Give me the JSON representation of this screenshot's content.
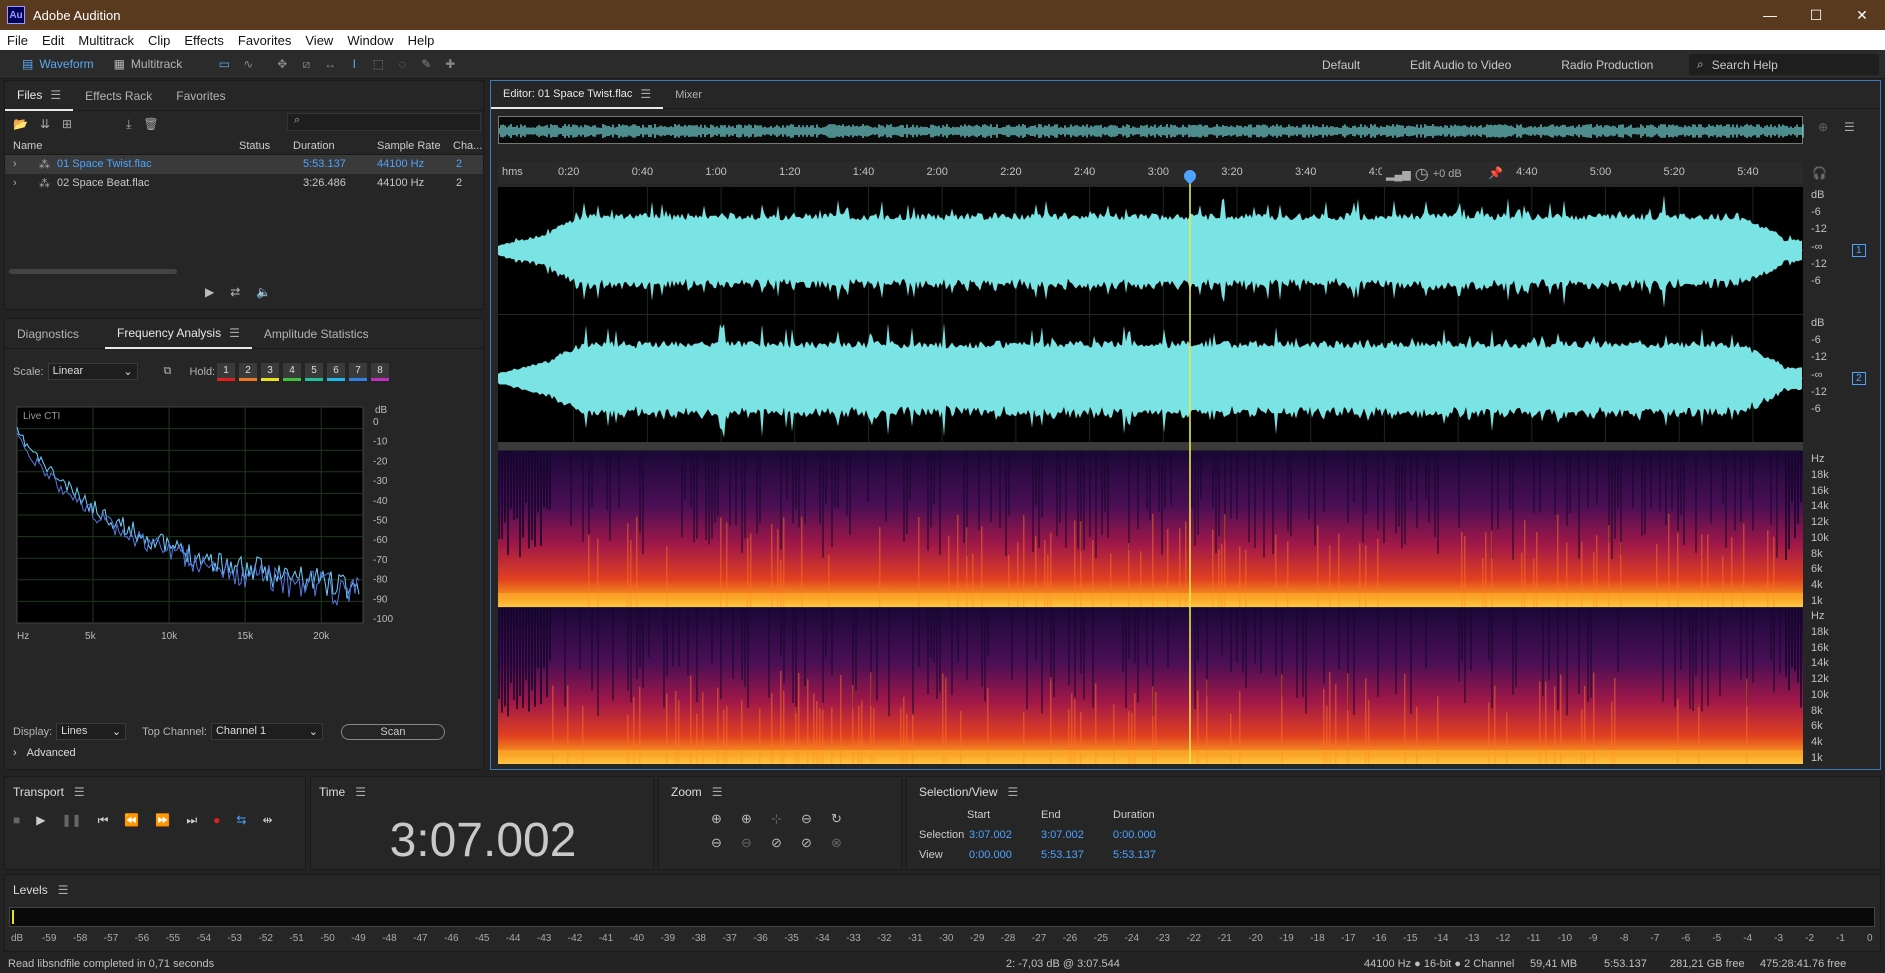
{
  "app": {
    "logo": "Au",
    "title": "Adobe Audition",
    "window_controls": [
      "—",
      "☐",
      "✕"
    ]
  },
  "menu": [
    "File",
    "Edit",
    "Multitrack",
    "Clip",
    "Effects",
    "Favorites",
    "View",
    "Window",
    "Help"
  ],
  "toolbar": {
    "waveform": "Waveform",
    "multitrack": "Multitrack",
    "workspaces": [
      "Default",
      "Edit Audio to Video",
      "Radio Production"
    ],
    "more": "»",
    "search_placeholder": "Search Help"
  },
  "files": {
    "tabs": [
      "Files",
      "Effects Rack",
      "Favorites"
    ],
    "columns": [
      "Name",
      "Status",
      "Duration",
      "Sample Rate",
      "Cha..."
    ],
    "rows": [
      {
        "name": "01 Space Twist.flac",
        "status": "",
        "duration": "5:53.137",
        "rate": "44100 Hz",
        "channels": "2"
      },
      {
        "name": "02 Space Beat.flac",
        "status": "",
        "duration": "3:26.486",
        "rate": "44100 Hz",
        "channels": "2"
      }
    ]
  },
  "analysis": {
    "tabs": [
      "Diagnostics",
      "Frequency Analysis",
      "Amplitude Statistics"
    ],
    "scale_label": "Scale:",
    "scale_value": "Linear",
    "hold_label": "Hold:",
    "hold": [
      "1",
      "2",
      "3",
      "4",
      "5",
      "6",
      "7",
      "8"
    ],
    "hold_colors": [
      "#e02020",
      "#f07820",
      "#e8e020",
      "#40c040",
      "#20c0a0",
      "#20b8e8",
      "#3080e8",
      "#c030c0"
    ],
    "graph_title": "Live CTI",
    "db_unit": "dB",
    "db_ticks": [
      "0",
      "-10",
      "-20",
      "-30",
      "-40",
      "-50",
      "-60",
      "-70",
      "-80",
      "-90",
      "-100"
    ],
    "hz_ticks": [
      "Hz",
      "5k",
      "10k",
      "15k",
      "20k"
    ],
    "display_label": "Display:",
    "display_value": "Lines",
    "top_channel_label": "Top Channel:",
    "top_channel_value": "Channel 1",
    "scan": "Scan",
    "advanced": "Advanced"
  },
  "editor": {
    "tabs": [
      "Editor: 01 Space Twist.flac",
      "Mixer"
    ],
    "ruler_unit": "hms",
    "ruler_ticks": [
      "0:20",
      "0:40",
      "1:00",
      "1:20",
      "1:40",
      "2:00",
      "2:20",
      "2:40",
      "3:00",
      "3:20",
      "3:40",
      "4:00",
      "4:20",
      "4:40",
      "5:00",
      "5:20",
      "5:40"
    ],
    "hud_gain": "+0 dB",
    "db_labels": [
      "dB",
      "-6",
      "-12",
      "-∞",
      "-12",
      "-6"
    ],
    "channel_badges": [
      "1",
      "2"
    ],
    "hz_labels": [
      "Hz",
      "18k",
      "16k",
      "14k",
      "12k",
      "10k",
      "8k",
      "6k",
      "4k",
      "1k"
    ],
    "playhead_fraction": 0.5298,
    "waveform_color": "#7ae4e4"
  },
  "transport": {
    "title": "Transport"
  },
  "time": {
    "title": "Time",
    "value": "3:07.002"
  },
  "zoom": {
    "title": "Zoom"
  },
  "selection": {
    "title": "Selection/View",
    "cols": [
      "Start",
      "End",
      "Duration"
    ],
    "rows": [
      {
        "label": "Selection",
        "start": "3:07.002",
        "end": "3:07.002",
        "duration": "0:00.000"
      },
      {
        "label": "View",
        "start": "0:00.000",
        "end": "5:53.137",
        "duration": "5:53.137"
      }
    ]
  },
  "levels": {
    "title": "Levels",
    "ticks": [
      "dB",
      "-59",
      "-58",
      "-57",
      "-56",
      "-55",
      "-54",
      "-53",
      "-52",
      "-51",
      "-50",
      "-49",
      "-48",
      "-47",
      "-46",
      "-45",
      "-44",
      "-43",
      "-42",
      "-41",
      "-40",
      "-39",
      "-38",
      "-37",
      "-36",
      "-35",
      "-34",
      "-33",
      "-32",
      "-31",
      "-30",
      "-29",
      "-28",
      "-27",
      "-26",
      "-25",
      "-24",
      "-23",
      "-22",
      "-21",
      "-20",
      "-19",
      "-18",
      "-17",
      "-16",
      "-15",
      "-14",
      "-13",
      "-12",
      "-11",
      "-10",
      "-9",
      "-8",
      "-7",
      "-6",
      "-5",
      "-4",
      "-3",
      "-2",
      "-1",
      "0"
    ]
  },
  "status": {
    "left": "Read libsndfile completed in 0,71 seconds",
    "cursor": "2: -7,03 dB @ 3:07.544",
    "format": "44100 Hz ● 16-bit ● 2 Channel",
    "size": "59,41 MB",
    "duration": "5:53.137",
    "free": "281,21 GB free",
    "remaining": "475:28:41.76 free"
  }
}
